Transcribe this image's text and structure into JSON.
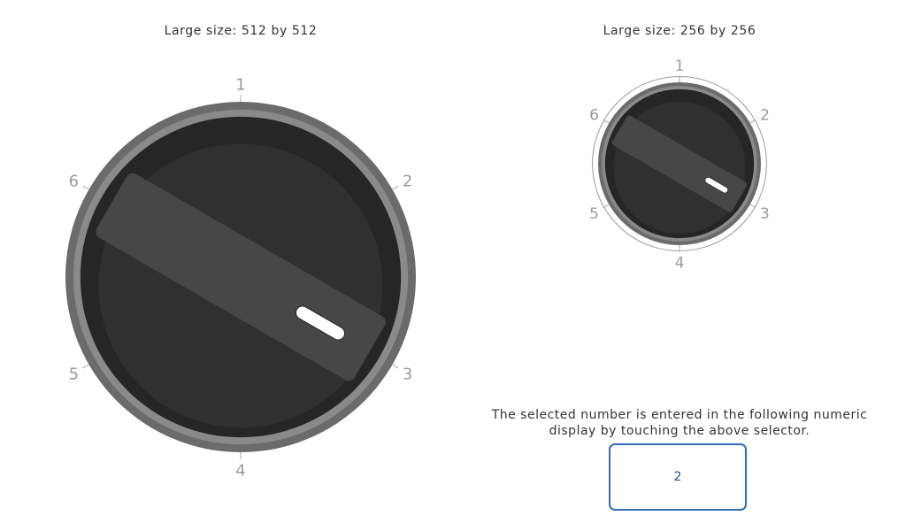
{
  "dials": {
    "large": {
      "caption": "Large size: 512 by 512",
      "positions": [
        "1",
        "2",
        "3",
        "4",
        "5",
        "6"
      ],
      "selected": "2"
    },
    "small": {
      "caption": "Large size: 256 by 256",
      "positions": [
        "1",
        "2",
        "3",
        "4",
        "5",
        "6"
      ],
      "selected": "2"
    }
  },
  "display": {
    "instructions_line1": "The selected number is entered in the following numeric",
    "instructions_line2": "display by touching the above selector.",
    "value": "2"
  },
  "colors": {
    "outer_ring": "#6b6b6b",
    "inner_ring": "#8a8a8a",
    "dial_face": "#262626",
    "dial_center": "#303030",
    "knob": "#474747",
    "indicator": "#ffffff",
    "tick_label": "#9b9b9b",
    "display_border": "#2f6db5"
  }
}
